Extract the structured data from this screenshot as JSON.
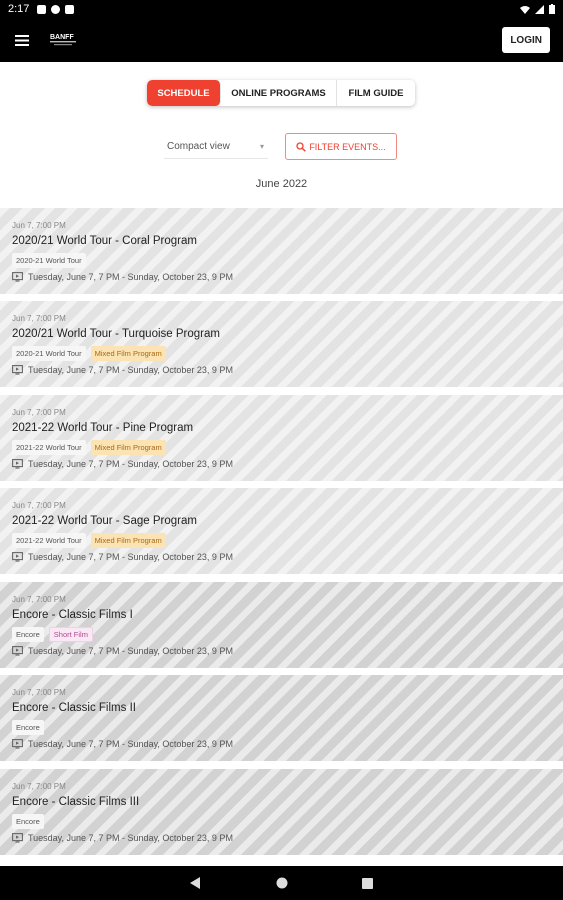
{
  "status_bar": {
    "time": "2:17"
  },
  "app_bar": {
    "logo_text": "BANFF",
    "login_label": "LOGIN"
  },
  "tabs": [
    {
      "label": "SCHEDULE",
      "active": true
    },
    {
      "label": "ONLINE PROGRAMS",
      "active": false
    },
    {
      "label": "FILM GUIDE",
      "active": false
    }
  ],
  "view_select": {
    "value": "Compact view"
  },
  "filter": {
    "label": "FILTER EVENTS..."
  },
  "month_heading": "June 2022",
  "events": [
    {
      "date": "Jun 7, 7:00 PM",
      "title": "2020/21 World Tour - Coral Program",
      "tags": [
        "2020-21 World Tour"
      ],
      "when": "Tuesday, June 7, 7 PM - Sunday, October 23, 9 PM"
    },
    {
      "date": "Jun 7, 7:00 PM",
      "title": "2020/21 World Tour - Turquoise Program",
      "tags": [
        "2020-21 World Tour",
        "Mixed Film Program"
      ],
      "when": "Tuesday, June 7, 7 PM - Sunday, October 23, 9 PM"
    },
    {
      "date": "Jun 7, 7:00 PM",
      "title": "2021-22 World Tour - Pine Program",
      "tags": [
        "2021-22 World Tour",
        "Mixed Film Program"
      ],
      "when": "Tuesday, June 7, 7 PM - Sunday, October 23, 9 PM"
    },
    {
      "date": "Jun 7, 7:00 PM",
      "title": "2021-22 World Tour - Sage Program",
      "tags": [
        "2021-22 World Tour",
        "Mixed Film Program"
      ],
      "when": "Tuesday, June 7, 7 PM - Sunday, October 23, 9 PM"
    },
    {
      "date": "Jun 7, 7:00 PM",
      "title": "Encore - Classic Films I",
      "tags": [
        "Encore",
        "Short Film"
      ],
      "when": "Tuesday, June 7, 7 PM - Sunday, October 23, 9 PM"
    },
    {
      "date": "Jun 7, 7:00 PM",
      "title": "Encore - Classic Films II",
      "tags": [
        "Encore"
      ],
      "when": "Tuesday, June 7, 7 PM - Sunday, October 23, 9 PM"
    },
    {
      "date": "Jun 7, 7:00 PM",
      "title": "Encore - Classic Films III",
      "tags": [
        "Encore"
      ],
      "when": "Tuesday, June 7, 7 PM - Sunday, October 23, 9 PM"
    }
  ],
  "colors": {
    "accent": "#ef4130",
    "film_tag": "#fbe3b4",
    "short_tag": "#fae8f5"
  }
}
